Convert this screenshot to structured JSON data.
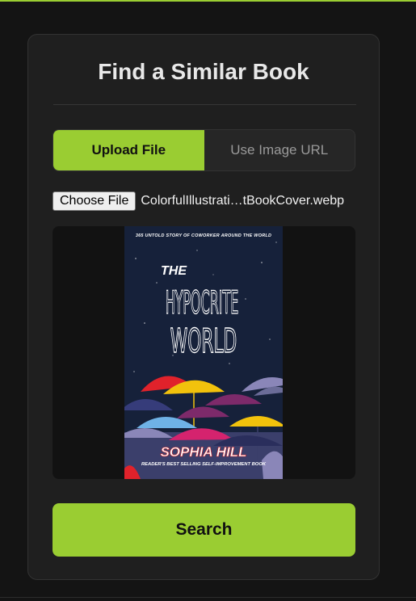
{
  "page": {
    "title": "Find a Similar Book"
  },
  "tabs": [
    {
      "label": "Upload File",
      "active": true
    },
    {
      "label": "Use Image URL",
      "active": false
    }
  ],
  "file_input": {
    "button_label": "Choose File",
    "filename": "ColorfulIllustrati…tBookCover.webp"
  },
  "cover": {
    "tagline": "365 UNTOLD STORY OF COWORKER AROUND THE WORLD",
    "title_line1": "THE",
    "title_line2": "HYPOCRITE",
    "title_line3": "WORLD",
    "author": "SOPHIA HILL",
    "subtitle": "READER'S BEST SELLING SELF-IMPROVEMENT BOOK"
  },
  "search_button": {
    "label": "Search"
  },
  "colors": {
    "accent": "#9acd32",
    "background": "#141414",
    "card": "#1f1f1f",
    "cover_sky": "#16213a",
    "cover_author": "#d8262b"
  }
}
